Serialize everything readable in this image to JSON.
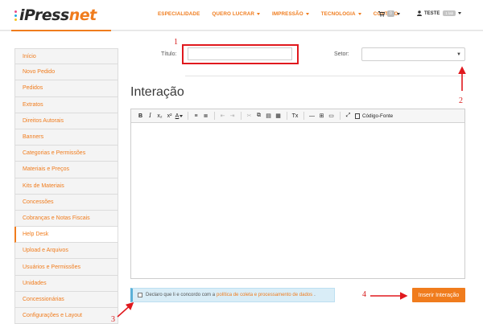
{
  "logo": {
    "part1": "iPress",
    "part2": "net"
  },
  "colors": {
    "accent": "#f07c1d",
    "annotation": "#e0191e",
    "info_bg": "#d9edf7"
  },
  "nav": [
    {
      "label": "ESPECIALIDADE"
    },
    {
      "label": "QUERO LUCRAR"
    },
    {
      "label": "IMPRESSÃO"
    },
    {
      "label": "TECNOLOGIA"
    },
    {
      "label": "CONTATO"
    }
  ],
  "cart": {
    "icon": "cart-icon",
    "count": "0"
  },
  "user": {
    "icon": "user-icon",
    "name": "TESTE",
    "badge": "1 lab"
  },
  "sidebar": {
    "items": [
      {
        "label": "Início"
      },
      {
        "label": "Novo Pedido"
      },
      {
        "label": "Pedidos"
      },
      {
        "label": "Extratos"
      },
      {
        "label": "Direitos Autorais"
      },
      {
        "label": "Banners"
      },
      {
        "label": "Categorias e Permissões"
      },
      {
        "label": "Materiais e Preços"
      },
      {
        "label": "Kits de Materiais"
      },
      {
        "label": "Concessões"
      },
      {
        "label": "Cobranças e Notas Fiscais"
      },
      {
        "label": "Help Desk",
        "active": true
      },
      {
        "label": "Upload e Arquivos"
      },
      {
        "label": "Usuários e Permissões"
      },
      {
        "label": "Unidades"
      },
      {
        "label": "Concessionárias"
      },
      {
        "label": "Configurações e Layout"
      }
    ]
  },
  "form": {
    "title_label": "Título:",
    "title_value": "",
    "setor_label": "Setor:",
    "setor_value": ""
  },
  "section_title": "Interação",
  "editor": {
    "toolbar": [
      "B",
      "I",
      "x₂",
      "x²",
      "A",
      "≡",
      "≣",
      "⇤",
      "⇥",
      "✂",
      "⧉",
      "▤",
      "▦",
      "Tx",
      "—",
      "⊞",
      "▭",
      "⤢"
    ],
    "source_label": "Código-Fonte",
    "content": ""
  },
  "consent": {
    "prefix": "Declaro que li e concordo com a",
    "link": "política de coleta e processamento de dados",
    "suffix": "."
  },
  "insert_button": "Inserir Interação",
  "annotations": [
    "1",
    "2",
    "3",
    "4"
  ]
}
